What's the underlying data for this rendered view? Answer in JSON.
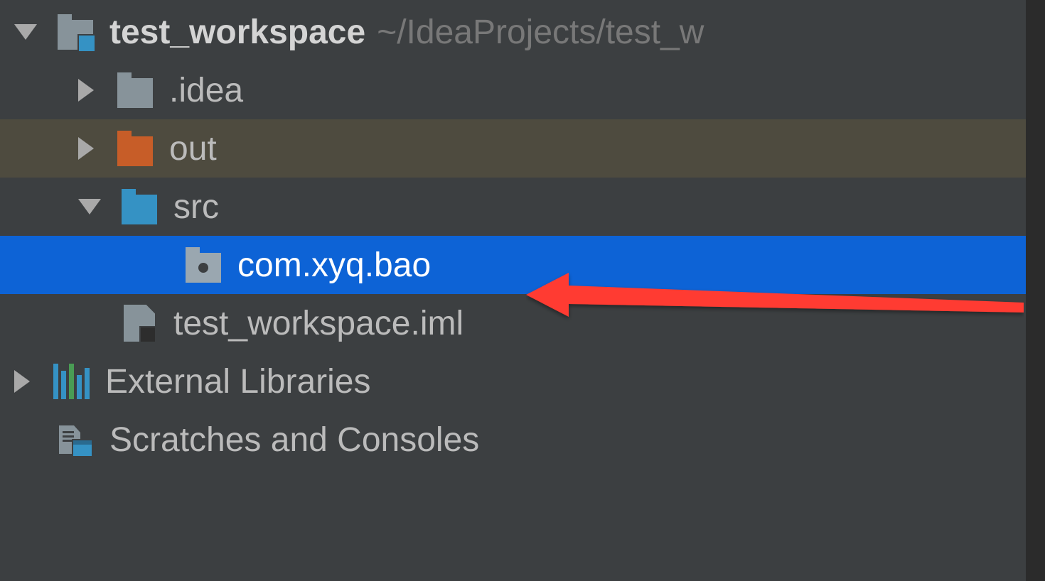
{
  "project": {
    "name": "test_workspace",
    "path": "~/IdeaProjects/test_w"
  },
  "tree": {
    "idea_folder": ".idea",
    "out_folder": "out",
    "src_folder": "src",
    "package_name": "com.xyq.bao",
    "iml_file": "test_workspace.iml",
    "external_libraries": "External Libraries",
    "scratches": "Scratches and Consoles"
  }
}
